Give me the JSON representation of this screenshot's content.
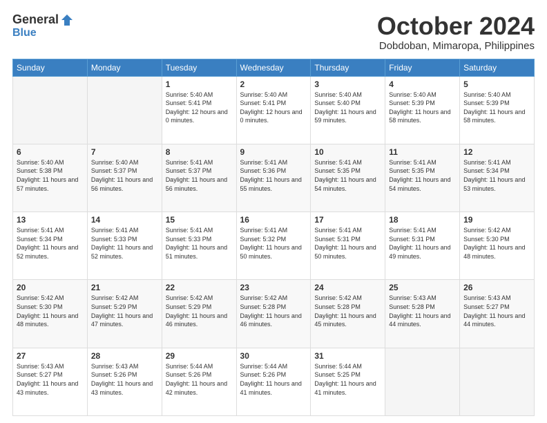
{
  "header": {
    "logo_general": "General",
    "logo_blue": "Blue",
    "month_title": "October 2024",
    "location": "Dobdoban, Mimaropa, Philippines"
  },
  "days_of_week": [
    "Sunday",
    "Monday",
    "Tuesday",
    "Wednesday",
    "Thursday",
    "Friday",
    "Saturday"
  ],
  "weeks": [
    [
      {
        "day": "",
        "sunrise": "",
        "sunset": "",
        "daylight": ""
      },
      {
        "day": "",
        "sunrise": "",
        "sunset": "",
        "daylight": ""
      },
      {
        "day": "1",
        "sunrise": "Sunrise: 5:40 AM",
        "sunset": "Sunset: 5:41 PM",
        "daylight": "Daylight: 12 hours and 0 minutes."
      },
      {
        "day": "2",
        "sunrise": "Sunrise: 5:40 AM",
        "sunset": "Sunset: 5:41 PM",
        "daylight": "Daylight: 12 hours and 0 minutes."
      },
      {
        "day": "3",
        "sunrise": "Sunrise: 5:40 AM",
        "sunset": "Sunset: 5:40 PM",
        "daylight": "Daylight: 11 hours and 59 minutes."
      },
      {
        "day": "4",
        "sunrise": "Sunrise: 5:40 AM",
        "sunset": "Sunset: 5:39 PM",
        "daylight": "Daylight: 11 hours and 58 minutes."
      },
      {
        "day": "5",
        "sunrise": "Sunrise: 5:40 AM",
        "sunset": "Sunset: 5:39 PM",
        "daylight": "Daylight: 11 hours and 58 minutes."
      }
    ],
    [
      {
        "day": "6",
        "sunrise": "Sunrise: 5:40 AM",
        "sunset": "Sunset: 5:38 PM",
        "daylight": "Daylight: 11 hours and 57 minutes."
      },
      {
        "day": "7",
        "sunrise": "Sunrise: 5:40 AM",
        "sunset": "Sunset: 5:37 PM",
        "daylight": "Daylight: 11 hours and 56 minutes."
      },
      {
        "day": "8",
        "sunrise": "Sunrise: 5:41 AM",
        "sunset": "Sunset: 5:37 PM",
        "daylight": "Daylight: 11 hours and 56 minutes."
      },
      {
        "day": "9",
        "sunrise": "Sunrise: 5:41 AM",
        "sunset": "Sunset: 5:36 PM",
        "daylight": "Daylight: 11 hours and 55 minutes."
      },
      {
        "day": "10",
        "sunrise": "Sunrise: 5:41 AM",
        "sunset": "Sunset: 5:35 PM",
        "daylight": "Daylight: 11 hours and 54 minutes."
      },
      {
        "day": "11",
        "sunrise": "Sunrise: 5:41 AM",
        "sunset": "Sunset: 5:35 PM",
        "daylight": "Daylight: 11 hours and 54 minutes."
      },
      {
        "day": "12",
        "sunrise": "Sunrise: 5:41 AM",
        "sunset": "Sunset: 5:34 PM",
        "daylight": "Daylight: 11 hours and 53 minutes."
      }
    ],
    [
      {
        "day": "13",
        "sunrise": "Sunrise: 5:41 AM",
        "sunset": "Sunset: 5:34 PM",
        "daylight": "Daylight: 11 hours and 52 minutes."
      },
      {
        "day": "14",
        "sunrise": "Sunrise: 5:41 AM",
        "sunset": "Sunset: 5:33 PM",
        "daylight": "Daylight: 11 hours and 52 minutes."
      },
      {
        "day": "15",
        "sunrise": "Sunrise: 5:41 AM",
        "sunset": "Sunset: 5:33 PM",
        "daylight": "Daylight: 11 hours and 51 minutes."
      },
      {
        "day": "16",
        "sunrise": "Sunrise: 5:41 AM",
        "sunset": "Sunset: 5:32 PM",
        "daylight": "Daylight: 11 hours and 50 minutes."
      },
      {
        "day": "17",
        "sunrise": "Sunrise: 5:41 AM",
        "sunset": "Sunset: 5:31 PM",
        "daylight": "Daylight: 11 hours and 50 minutes."
      },
      {
        "day": "18",
        "sunrise": "Sunrise: 5:41 AM",
        "sunset": "Sunset: 5:31 PM",
        "daylight": "Daylight: 11 hours and 49 minutes."
      },
      {
        "day": "19",
        "sunrise": "Sunrise: 5:42 AM",
        "sunset": "Sunset: 5:30 PM",
        "daylight": "Daylight: 11 hours and 48 minutes."
      }
    ],
    [
      {
        "day": "20",
        "sunrise": "Sunrise: 5:42 AM",
        "sunset": "Sunset: 5:30 PM",
        "daylight": "Daylight: 11 hours and 48 minutes."
      },
      {
        "day": "21",
        "sunrise": "Sunrise: 5:42 AM",
        "sunset": "Sunset: 5:29 PM",
        "daylight": "Daylight: 11 hours and 47 minutes."
      },
      {
        "day": "22",
        "sunrise": "Sunrise: 5:42 AM",
        "sunset": "Sunset: 5:29 PM",
        "daylight": "Daylight: 11 hours and 46 minutes."
      },
      {
        "day": "23",
        "sunrise": "Sunrise: 5:42 AM",
        "sunset": "Sunset: 5:28 PM",
        "daylight": "Daylight: 11 hours and 46 minutes."
      },
      {
        "day": "24",
        "sunrise": "Sunrise: 5:42 AM",
        "sunset": "Sunset: 5:28 PM",
        "daylight": "Daylight: 11 hours and 45 minutes."
      },
      {
        "day": "25",
        "sunrise": "Sunrise: 5:43 AM",
        "sunset": "Sunset: 5:28 PM",
        "daylight": "Daylight: 11 hours and 44 minutes."
      },
      {
        "day": "26",
        "sunrise": "Sunrise: 5:43 AM",
        "sunset": "Sunset: 5:27 PM",
        "daylight": "Daylight: 11 hours and 44 minutes."
      }
    ],
    [
      {
        "day": "27",
        "sunrise": "Sunrise: 5:43 AM",
        "sunset": "Sunset: 5:27 PM",
        "daylight": "Daylight: 11 hours and 43 minutes."
      },
      {
        "day": "28",
        "sunrise": "Sunrise: 5:43 AM",
        "sunset": "Sunset: 5:26 PM",
        "daylight": "Daylight: 11 hours and 43 minutes."
      },
      {
        "day": "29",
        "sunrise": "Sunrise: 5:44 AM",
        "sunset": "Sunset: 5:26 PM",
        "daylight": "Daylight: 11 hours and 42 minutes."
      },
      {
        "day": "30",
        "sunrise": "Sunrise: 5:44 AM",
        "sunset": "Sunset: 5:26 PM",
        "daylight": "Daylight: 11 hours and 41 minutes."
      },
      {
        "day": "31",
        "sunrise": "Sunrise: 5:44 AM",
        "sunset": "Sunset: 5:25 PM",
        "daylight": "Daylight: 11 hours and 41 minutes."
      },
      {
        "day": "",
        "sunrise": "",
        "sunset": "",
        "daylight": ""
      },
      {
        "day": "",
        "sunrise": "",
        "sunset": "",
        "daylight": ""
      }
    ]
  ]
}
